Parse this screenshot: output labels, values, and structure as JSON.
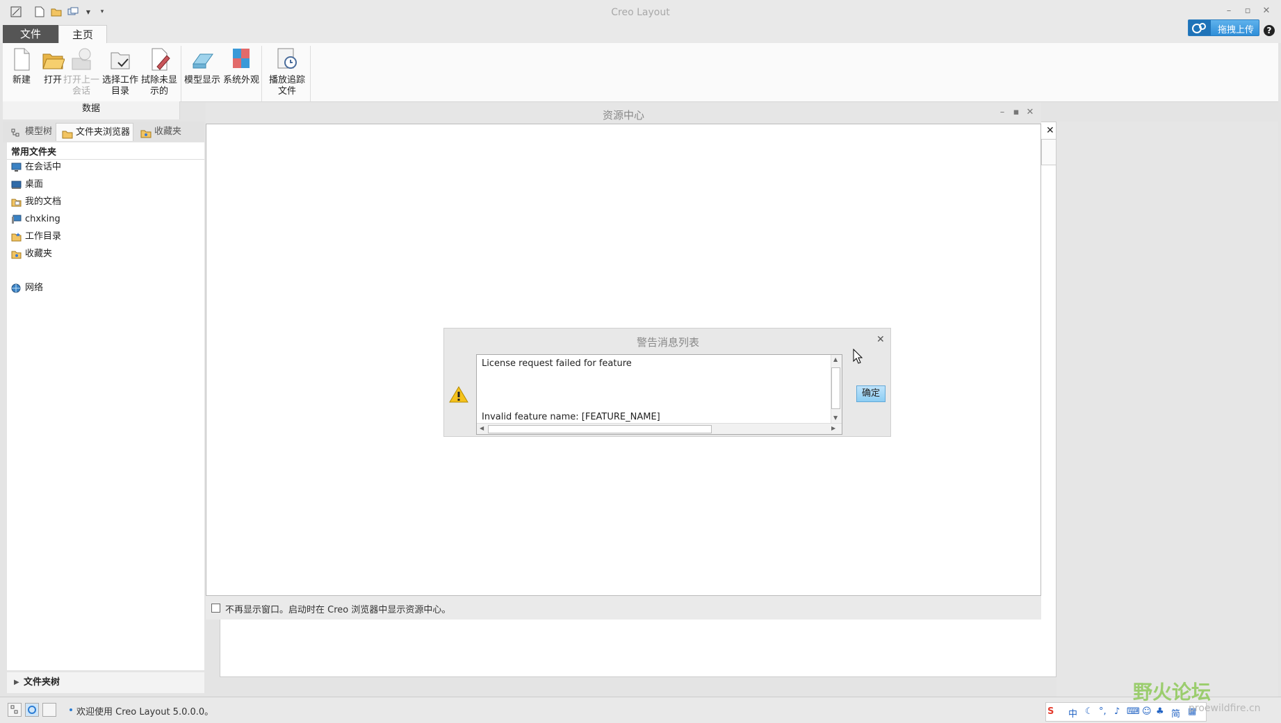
{
  "app": {
    "title": "Creo Layout"
  },
  "ribbon": {
    "tabs": [
      {
        "label": "文件"
      },
      {
        "label": "主页"
      }
    ],
    "upload_label": "拖拽上传",
    "help_label": "?",
    "buttons": [
      {
        "label": "新建"
      },
      {
        "label": "打开"
      },
      {
        "label": "打开上一会话"
      },
      {
        "label": "选择工作目录"
      },
      {
        "label": "拭除未显示的"
      },
      {
        "label": "模型显示"
      },
      {
        "label": "系统外观"
      },
      {
        "label": "播放追踪文件"
      }
    ],
    "group_label": "数据"
  },
  "nav_tabs": [
    {
      "label": "模型树",
      "icon": "tree-icon"
    },
    {
      "label": "文件夹浏览器",
      "icon": "folder-browser-icon"
    },
    {
      "label": "收藏夹",
      "icon": "favorites-icon"
    }
  ],
  "left_panel": {
    "header": "常用文件夹",
    "items": [
      {
        "label": "在会话中",
        "icon": "monitor-icon"
      },
      {
        "label": "桌面",
        "icon": "desktop-icon"
      },
      {
        "label": "我的文档",
        "icon": "documents-icon"
      },
      {
        "label": "chxking",
        "icon": "computer-icon"
      },
      {
        "label": "工作目录",
        "icon": "work-folder-icon"
      },
      {
        "label": "收藏夹",
        "icon": "favorites-icon"
      },
      {
        "label": "网络",
        "icon": "network-icon"
      }
    ],
    "folder_tree_label": "文件夹树"
  },
  "resource_center": {
    "title": "资源中心",
    "footer_text": "不再显示窗口。启动时在 Creo 浏览器中显示资源中心。"
  },
  "warning_dialog": {
    "title": "警告消息列表",
    "line1": "License request failed for feature",
    "line2": "Invalid feature name: [FEATURE_NAME]",
    "ok_label": "确定"
  },
  "status": {
    "message": "欢迎使用 Creo Layout 5.0.0.0。"
  },
  "ime": {
    "items": [
      "中",
      "简"
    ]
  },
  "watermark": {
    "text": "野火论坛",
    "sub": "proewildfire.cn"
  },
  "colors": {
    "accent": "#2f8ed8",
    "ok_button": "#8ccdf3",
    "file_tab": "#555555"
  }
}
